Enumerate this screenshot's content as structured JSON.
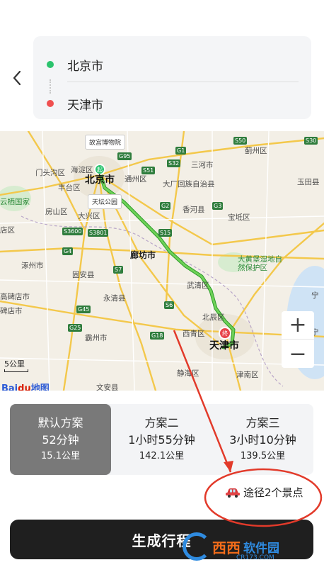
{
  "route": {
    "from": "北京市",
    "to": "天津市"
  },
  "map": {
    "labels": {
      "beijing": "北京市",
      "tianjin": "天津市",
      "langfang": "廊坊市",
      "haidian": "海淀区",
      "mentougou": "门头沟区",
      "fengtai": "丰台区",
      "tongzhou": "通州区",
      "sanhe": "三河市",
      "jizhou": "蓟州区",
      "yutian": "玉田县",
      "fangshan": "房山区",
      "daxing": "大兴区",
      "dachang": "大厂回族自治县",
      "xianghe": "香河县",
      "baodi": "宝坻区",
      "zhuozhou": "涿州市",
      "guan": "固安县",
      "yongqing": "永清县",
      "wuqing": "武清区",
      "bazhou": "霸州市",
      "xiqing": "西青区",
      "beichen": "北辰区",
      "jinghai": "静海区",
      "jinnan": "津南区",
      "wenan": "文安县",
      "gaobeidian": "高碑店市",
      "zhuohe": "涿州",
      "dahuangbao": "大黄堡湿地自然保护区",
      "yunjuyun": "云栖国家",
      "ning": "宁",
      "ning2": "宁",
      "dian": "碑店市",
      "dian2": "店区"
    },
    "callouts": {
      "palace": "故宫博物院",
      "temple": "天坛公园"
    },
    "shields": [
      "G95",
      "S51",
      "G1",
      "S32",
      "S50",
      "S30",
      "G3",
      "S15",
      "G2",
      "S3801",
      "G4",
      "S3600",
      "S7",
      "G18",
      "G45",
      "S6",
      "G25",
      "S7"
    ],
    "scale": "5公里",
    "logo_bai": "Bai",
    "logo_du": "du",
    "logo_map": "地图",
    "start_marker": "起",
    "end_marker": "终",
    "zoom_in": "+",
    "zoom_out": "−"
  },
  "plans": [
    {
      "name": "默认方案",
      "time": "52分钟",
      "distance": "15.1公里"
    },
    {
      "name": "方案二",
      "time": "1小时55分钟",
      "distance": "142.1公里"
    },
    {
      "name": "方案三",
      "time": "3小时10分钟",
      "distance": "139.5公里"
    }
  ],
  "scenic": "途径2个景点",
  "generate": "生成行程",
  "watermark": {
    "brand": "西西",
    "sub": "软件园",
    "url": "CR173.COM"
  },
  "colors": {
    "route": "#46b83a",
    "start": "#2bc36d",
    "end": "#f05050",
    "annotation": "#e23a2a",
    "active_plan": "#797979"
  }
}
